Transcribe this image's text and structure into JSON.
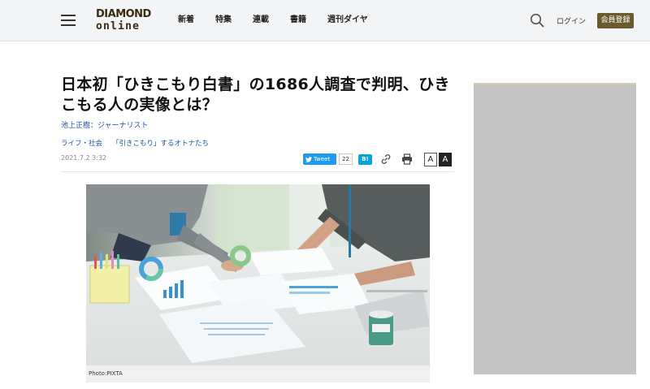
{
  "header": {
    "logo_line1": "DIAMOND",
    "logo_line2": "online",
    "nav": [
      "新着",
      "特集",
      "連載",
      "書籍",
      "週刊ダイヤ"
    ],
    "login": "ログイン",
    "register": "会員登録"
  },
  "article": {
    "title": "日本初「ひきこもり白書」の1686人調査で判明、ひきこもる人の実像とは？",
    "author": "池上正樹：ジャーナリスト",
    "category": "ライフ・社会",
    "series": "「引きこもり」するオトナたち",
    "date": "2021.7.2 3:32",
    "photo_caption": "Photo:PIXTA"
  },
  "share": {
    "tweet_label": "Tweet",
    "tweet_count": "22",
    "hatena_label": "B!",
    "font_small": "A",
    "font_large": "A"
  },
  "colors": {
    "brand": "#6b5a2c",
    "link": "#1a4fa6",
    "twitter": "#1d9bf0",
    "hatena": "#00a4de"
  }
}
